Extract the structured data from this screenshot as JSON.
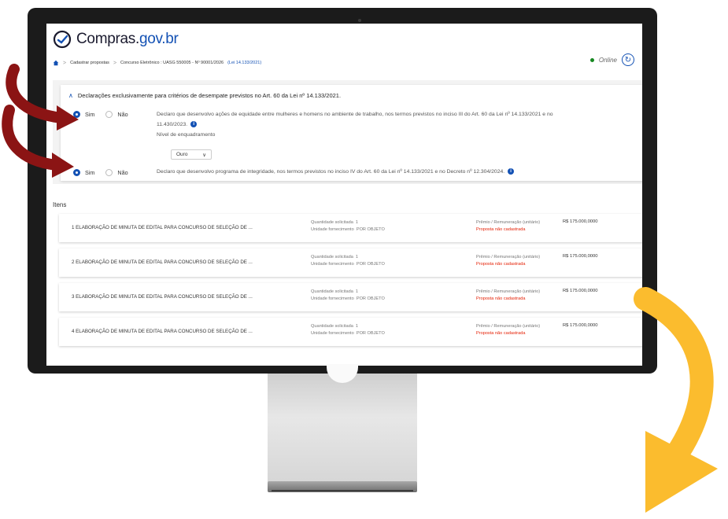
{
  "app": {
    "logo_prefix": "Compras.",
    "logo_suffix": "gov.br",
    "status": "Online"
  },
  "breadcrumb": {
    "items": [
      "Cadastrar propostas",
      "Concurso Eletrônico : UASG 550005 - Nº 90001/2026"
    ],
    "law": "(Lei 14.133/2021)"
  },
  "declarations": {
    "title": "Declarações exclusivamente para critérios de desempate previstos no Art. 60 da Lei nº 14.133/2021.",
    "yes_label": "Sim",
    "no_label": "Não",
    "items": [
      {
        "text_line1": "Declaro que desenvolvo ações de equidade entre mulheres e homens no ambiente de trabalho, nos termos previstos no inciso III do Art. 60 da Lei nº 14.133/2021 e no",
        "text_line2": "11.430/2023.",
        "selected": "Sim"
      },
      {
        "text_line1": "Declaro que desenvolvo programa de integridade, nos termos previstos no inciso IV do Art. 60 da Lei nº 14.133/2021 e no Decreto nº 12.304/2024.",
        "selected": "Sim"
      }
    ],
    "level_label": "Nível de enquadramento",
    "level_value": "Ouro"
  },
  "items_section": {
    "title": "Itens",
    "qty_label": "Quantidade solicitada",
    "unit_label": "Unidade fornecimento",
    "price_label": "Prêmio / Remuneração (unitário)",
    "rows": [
      {
        "name": "1  ELABORAÇÃO DE MINUTA DE EDITAL PARA CONCURSO DE SELEÇÃO DE ...",
        "qty": "1",
        "unit": "POR OBJETO",
        "value": "R$ 175.000,0000",
        "status": "Proposta não cadastrada"
      },
      {
        "name": "2  ELABORAÇÃO DE MINUTA DE EDITAL PARA CONCURSO DE SELEÇÃO DE ...",
        "qty": "1",
        "unit": "POR OBJETO",
        "value": "R$ 175.000,0000",
        "status": "Proposta não cadastrada"
      },
      {
        "name": "3  ELABORAÇÃO DE MINUTA DE EDITAL PARA CONCURSO DE SELEÇÃO DE ...",
        "qty": "1",
        "unit": "POR OBJETO",
        "value": "R$ 175.000,0000",
        "status": "Proposta não cadastrada"
      },
      {
        "name": "4  ELABORAÇÃO DE MINUTA DE EDITAL PARA CONCURSO DE SELEÇÃO DE ...",
        "qty": "1",
        "unit": "POR OBJETO",
        "value": "R$ 175.000,0000",
        "status": "Proposta não cadastrada"
      }
    ]
  },
  "colors": {
    "accent": "#1351b4",
    "online": "#168821",
    "error": "#e52207",
    "dark_arrow": "#8b1414",
    "yellow_arrow": "#fbbc2e"
  },
  "icons": [
    "home-icon",
    "refresh-icon",
    "info-icon",
    "chevron-up-icon",
    "chevron-down-icon",
    "curved-arrow-icon"
  ]
}
